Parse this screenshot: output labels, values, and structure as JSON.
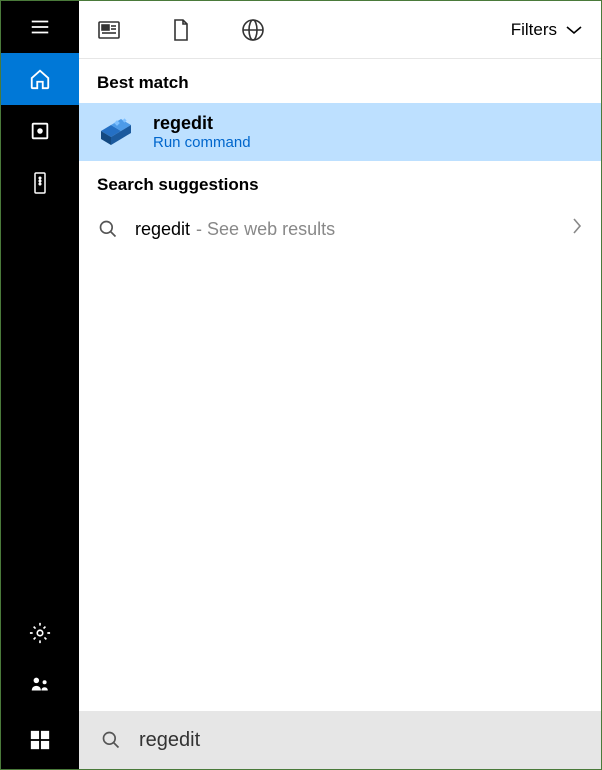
{
  "sidebar": {
    "hamburger": "menu-icon",
    "home": "home-icon",
    "apps": "apps-icon",
    "remote": "remote-icon",
    "settings": "gear-icon",
    "feedback": "feedback-icon",
    "start": "windows-icon"
  },
  "topbar": {
    "news": "news-icon",
    "document": "document-icon",
    "web": "globe-icon",
    "filters_label": "Filters"
  },
  "results": {
    "best_match_label": "Best match",
    "best_match": {
      "title": "regedit",
      "subtitle": "Run command"
    },
    "suggestions_label": "Search suggestions",
    "suggestion": {
      "term": "regedit",
      "hint": "- See web results"
    }
  },
  "search": {
    "value": "regedit"
  }
}
